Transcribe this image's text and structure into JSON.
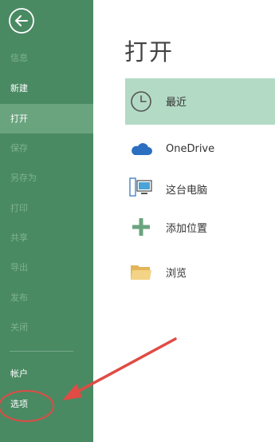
{
  "sidebar": {
    "back_icon": "back-arrow-icon",
    "items": [
      {
        "label": "信息",
        "state": "disabled"
      },
      {
        "label": "新建",
        "state": "enabled"
      },
      {
        "label": "打开",
        "state": "active"
      },
      {
        "label": "保存",
        "state": "disabled"
      },
      {
        "label": "另存为",
        "state": "disabled"
      },
      {
        "label": "打印",
        "state": "disabled"
      },
      {
        "label": "共享",
        "state": "disabled"
      },
      {
        "label": "导出",
        "state": "disabled"
      },
      {
        "label": "发布",
        "state": "disabled"
      },
      {
        "label": "关闭",
        "state": "disabled"
      }
    ],
    "account_label": "帐户",
    "options_label": "选项"
  },
  "main": {
    "title": "打开",
    "locations": [
      {
        "label": "最近",
        "icon": "clock-icon",
        "selected": true
      },
      {
        "label": "OneDrive",
        "icon": "cloud-icon",
        "selected": false
      },
      {
        "label": "这台电脑",
        "icon": "computer-icon",
        "selected": false
      },
      {
        "label": "添加位置",
        "icon": "plus-icon",
        "selected": false
      },
      {
        "label": "浏览",
        "icon": "folder-icon",
        "selected": false
      }
    ]
  },
  "colors": {
    "sidebar_bg": "#4a8a63",
    "sidebar_active": "#6aa47f",
    "selected_location": "#b3dac5",
    "annotation": "#e04b45"
  }
}
